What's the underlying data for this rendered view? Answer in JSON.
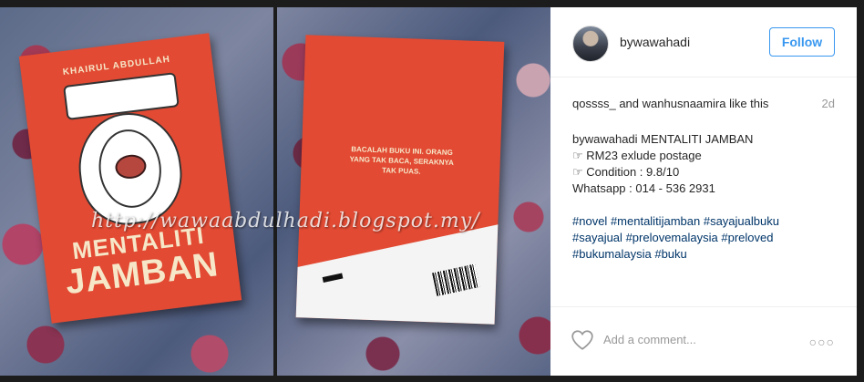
{
  "post": {
    "username": "bywawahadi",
    "follow_label": "Follow",
    "likes": {
      "user1": "qossss_",
      "joiner": "and",
      "user2": "wanhusnaamira",
      "suffix": "like this"
    },
    "time": "2d",
    "caption": {
      "author": "bywawahadi",
      "title": "MENTALITI JAMBAN",
      "line1": "☞ RM23 exlude postage",
      "line2": "☞ Condition : 9.8/10",
      "line3": "Whatsapp : 014 - 536 2931"
    },
    "hashtags": {
      "line1": [
        "#novel",
        "#mentalitijamban",
        "#sayajualbuku"
      ],
      "line2": [
        "#sayajual",
        "#prelovemalaysia",
        "#preloved"
      ],
      "line3": [
        "#bukumalaysia",
        "#buku"
      ]
    },
    "comment_placeholder": "Add a comment...",
    "more_label": "○○○"
  },
  "photo": {
    "watermark": "http://wawaabdulhadi.blogspot.my/",
    "front_cover": {
      "author": "KHAIRUL ABDULLAH",
      "title_line1": "MENTALITI",
      "title_line2": "JAMBAN"
    },
    "back_cover": {
      "blurb": "BACALAH BUKU INI. ORANG YANG TAK BACA, SERAKNYA TAK PUAS."
    }
  },
  "icons": {
    "heart": "heart-outline-icon",
    "more": "more-options-icon"
  },
  "colors": {
    "accent": "#3897f0",
    "hashtag": "#003569",
    "book": "#e24a33"
  }
}
